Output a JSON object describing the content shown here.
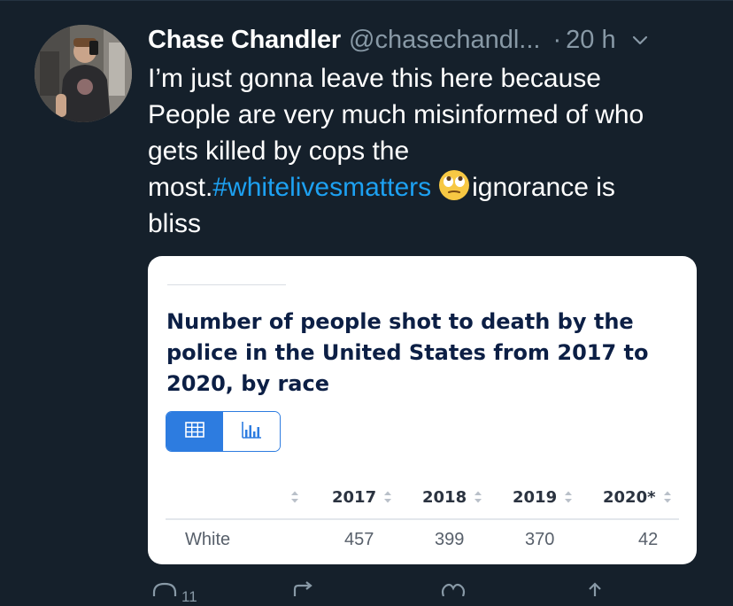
{
  "tweet": {
    "author_name": "Chase Chandler",
    "author_handle": "@chasechandl...",
    "separator": "·",
    "time": "20 h",
    "text_lines": [
      "I’m just gonna leave this here because",
      "People are very much misinformed of who",
      "gets killed by cops the"
    ],
    "text_line4_prefix": "most.",
    "hashtag": "#whitelivesmatters",
    "emoji": "eye-roll-emoji",
    "text_line4_suffix": "ignorance is",
    "text_line5": "bliss"
  },
  "card": {
    "title": "Number of people shot to death by the police in the United States from 2017 to 2020, by race",
    "view_toggle": {
      "active": "table",
      "options": [
        "table",
        "chart"
      ]
    },
    "table": {
      "columns": [
        "",
        "2017",
        "2018",
        "2019",
        "2020*"
      ],
      "rows": [
        {
          "label": "White",
          "values": [
            "457",
            "399",
            "370",
            "42"
          ]
        }
      ]
    }
  },
  "chart_data": {
    "type": "table",
    "title": "Number of people shot to death by the police in the United States from 2017 to 2020, by race",
    "columns": [
      "2017",
      "2018",
      "2019",
      "2020*"
    ],
    "rows": [
      {
        "label": "White",
        "values": [
          457,
          399,
          370,
          42
        ]
      }
    ]
  },
  "actions": {
    "reply_count": "11"
  },
  "colors": {
    "background": "#15202b",
    "text_primary": "#ffffff",
    "text_secondary": "#8899a6",
    "link": "#1da1f2",
    "toggle_accent": "#2d7ce0",
    "chart_title": "#0c1f45"
  }
}
